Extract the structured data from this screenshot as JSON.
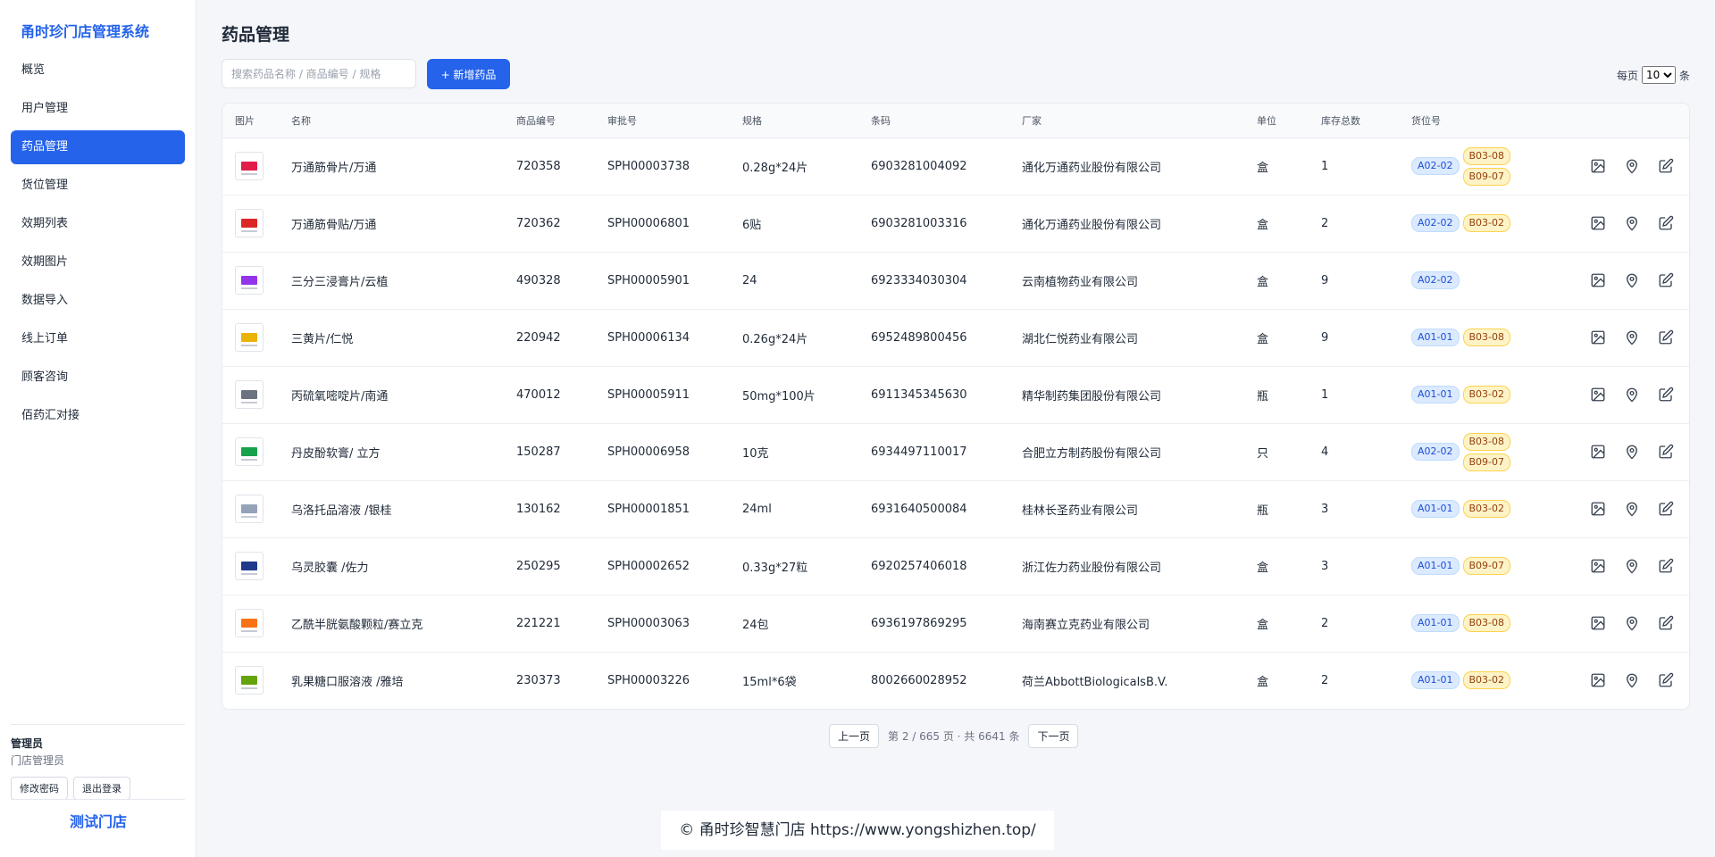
{
  "sidebar": {
    "brand": "甬时珍门店管理系统",
    "items": [
      {
        "label": "概览"
      },
      {
        "label": "用户管理"
      },
      {
        "label": "药品管理",
        "active": true
      },
      {
        "label": "货位管理"
      },
      {
        "label": "效期列表"
      },
      {
        "label": "效期图片"
      },
      {
        "label": "数据导入"
      },
      {
        "label": "线上订单"
      },
      {
        "label": "顾客咨询"
      },
      {
        "label": "佰药汇对接"
      }
    ],
    "user": {
      "name": "管理员",
      "role": "门店管理员",
      "change_password": "修改密码",
      "logout": "退出登录"
    },
    "store": "测试门店"
  },
  "header": {
    "title": "药品管理",
    "search_placeholder": "搜索药品名称 / 商品编号 / 规格",
    "add_button": "+ 新增药品",
    "page_size_prefix": "每页",
    "page_size_value": "10",
    "page_size_suffix": "条"
  },
  "table": {
    "columns": [
      "图片",
      "名称",
      "商品编号",
      "审批号",
      "规格",
      "条码",
      "厂家",
      "单位",
      "库存总数",
      "货位号"
    ],
    "rows": [
      {
        "name": "万通筋骨片/万通",
        "code": "720358",
        "approval": "SPH00003738",
        "spec": "0.28g*24片",
        "barcode": "6903281004092",
        "maker": "通化万通药业股份有限公司",
        "unit": "盒",
        "stock": "1",
        "locs": [
          "A02-02"
        ],
        "locs2": [
          "B03-08",
          "B09-07"
        ],
        "thumb": "#e11d48"
      },
      {
        "name": "万通筋骨贴/万通",
        "code": "720362",
        "approval": "SPH00006801",
        "spec": "6贴",
        "barcode": "6903281003316",
        "maker": "通化万通药业股份有限公司",
        "unit": "盒",
        "stock": "2",
        "locs": [
          "A02-02",
          "B03-02"
        ],
        "locs2": [],
        "thumb": "#dc2626"
      },
      {
        "name": "三分三浸膏片/云植",
        "code": "490328",
        "approval": "SPH00005901",
        "spec": "24",
        "barcode": "6923334030304",
        "maker": "云南植物药业有限公司",
        "unit": "盒",
        "stock": "9",
        "locs": [
          "A02-02"
        ],
        "locs2": [],
        "thumb": "#9333ea"
      },
      {
        "name": "三黄片/仁悦",
        "code": "220942",
        "approval": "SPH00006134",
        "spec": "0.26g*24片",
        "barcode": "6952489800456",
        "maker": "湖北仁悦药业有限公司",
        "unit": "盒",
        "stock": "9",
        "locs": [
          "A01-01",
          "B03-08"
        ],
        "locs2": [],
        "thumb": "#eab308"
      },
      {
        "name": "丙硫氧嘧啶片/南通",
        "code": "470012",
        "approval": "SPH00005911",
        "spec": "50mg*100片",
        "barcode": "6911345345630",
        "maker": "精华制药集团股份有限公司",
        "unit": "瓶",
        "stock": "1",
        "locs": [
          "A01-01",
          "B03-02"
        ],
        "locs2": [],
        "thumb": "#6b7280"
      },
      {
        "name": "丹皮酚软膏/ 立方",
        "code": "150287",
        "approval": "SPH00006958",
        "spec": "10克",
        "barcode": "6934497110017",
        "maker": "合肥立方制药股份有限公司",
        "unit": "只",
        "stock": "4",
        "locs": [
          "A02-02"
        ],
        "locs2": [
          "B03-08",
          "B09-07"
        ],
        "thumb": "#16a34a"
      },
      {
        "name": "乌洛托品溶液 /银桂",
        "code": "130162",
        "approval": "SPH00001851",
        "spec": "24ml",
        "barcode": "6931640500084",
        "maker": "桂林长圣药业有限公司",
        "unit": "瓶",
        "stock": "3",
        "locs": [
          "A01-01",
          "B03-02"
        ],
        "locs2": [],
        "thumb": "#94a3b8"
      },
      {
        "name": "乌灵胶囊 /佐力",
        "code": "250295",
        "approval": "SPH00002652",
        "spec": "0.33g*27粒",
        "barcode": "6920257406018",
        "maker": "浙江佐力药业股份有限公司",
        "unit": "盒",
        "stock": "3",
        "locs": [
          "A01-01",
          "B09-07"
        ],
        "locs2": [],
        "thumb": "#1e3a8a"
      },
      {
        "name": "乙酰半胱氨酸颗粒/赛立克",
        "code": "221221",
        "approval": "SPH00003063",
        "spec": "24包",
        "barcode": "6936197869295",
        "maker": "海南赛立克药业有限公司",
        "unit": "盒",
        "stock": "2",
        "locs": [
          "A01-01",
          "B03-08"
        ],
        "locs2": [],
        "thumb": "#f97316"
      },
      {
        "name": "乳果糖口服溶液 /雅培",
        "code": "230373",
        "approval": "SPH00003226",
        "spec": "15ml*6袋",
        "barcode": "8002660028952",
        "maker": "荷兰AbbottBiologicalsB.V.",
        "unit": "盒",
        "stock": "2",
        "locs": [
          "A01-01",
          "B03-02"
        ],
        "locs2": [],
        "thumb": "#65a30d"
      }
    ]
  },
  "pager": {
    "prev": "上一页",
    "info": "第 2 / 665 页 · 共 6641 条",
    "next": "下一页"
  },
  "footer": "© 甬时珍智慧门店  https://www.yongshizhen.top/",
  "colors": {
    "accent": "#2563eb",
    "tag_blue": "#dbeafe",
    "tag_amber": "#fef3c7"
  }
}
